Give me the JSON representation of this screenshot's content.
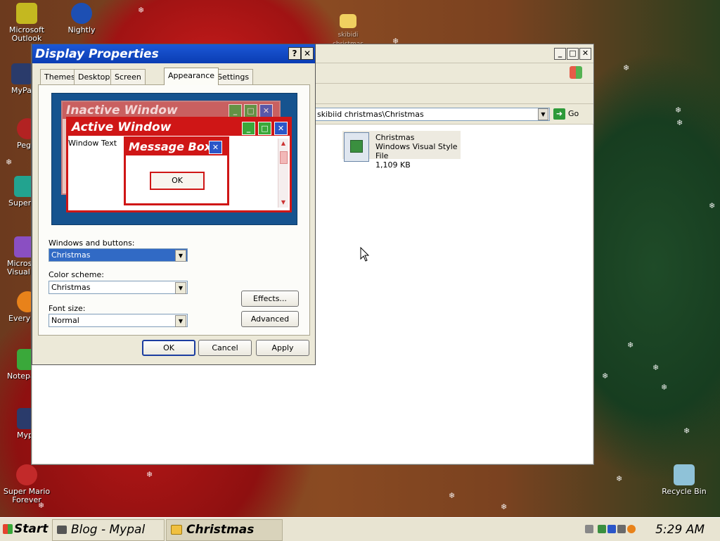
{
  "desktop": {
    "icons": [
      {
        "label": "Microsoft Outlook",
        "line1": "Microsoft",
        "line2": "Outlook",
        "icon": "outlook-icon",
        "color": "#c4b820"
      },
      {
        "label": "Nightly",
        "line1": "Nightly",
        "line2": "",
        "icon": "nightly-globe-icon",
        "color": "#1d4fb3"
      },
      {
        "label": "MyPal",
        "line1": "MyPal",
        "line2": "",
        "icon": "mypal-shortcut-icon",
        "color": "#2a3b6b"
      },
      {
        "label": "Peg",
        "line1": "Peg",
        "line2": "",
        "icon": "peg-shortcut-icon",
        "color": "#b22222"
      },
      {
        "label": "Super",
        "line1": "Super",
        "line2": "",
        "icon": "super-shortcut-icon",
        "color": "#22a38f"
      },
      {
        "label": "Micros Visual S",
        "line1": "Micros",
        "line2": "Visual S",
        "icon": "visual-studio-shortcut-icon",
        "color": "#8a4fc2"
      },
      {
        "label": "Everyo",
        "line1": "Everyo",
        "line2": "",
        "icon": "everything-shortcut-icon",
        "color": "#e8821a"
      },
      {
        "label": "Notepa",
        "line1": "Notepa",
        "line2": "",
        "icon": "notepad-shortcut-icon",
        "color": "#3aa83a"
      },
      {
        "label": "Myp",
        "line1": "Myp",
        "line2": "",
        "icon": "mypal2-shortcut-icon",
        "color": "#2a3b6b"
      },
      {
        "label": "Super Mario Forever",
        "line1": "Super Mario",
        "line2": "Forever",
        "icon": "super-mario-icon",
        "color": "#c22a2a"
      },
      {
        "label": "Recycle Bin",
        "line1": "Recycle Bin",
        "line2": "",
        "icon": "recycle-bin-icon",
        "color": "#8fc2d8"
      }
    ],
    "background_folder_label": "skibidi christmas"
  },
  "explorer": {
    "address": "skibiid christmas\\Christmas",
    "go_label": "Go",
    "file": {
      "name": "Christmas",
      "type": "Windows Visual Style File",
      "size": "1,109 KB"
    }
  },
  "dialog": {
    "title": "Display Properties",
    "help_label": "?",
    "close_label": "✕",
    "tabs": [
      {
        "label": "Themes",
        "active": false
      },
      {
        "label": "Desktop",
        "active": false
      },
      {
        "label": "Screen Saver",
        "active": false
      },
      {
        "label": "Appearance",
        "active": true
      },
      {
        "label": "Settings",
        "active": false
      }
    ],
    "preview": {
      "inactive_title": "Inactive Window",
      "active_title": "Active Window",
      "window_text": "Window Text",
      "message_box_title": "Message Box",
      "ok_label": "OK"
    },
    "windows_buttons_label": "Windows and buttons:",
    "windows_buttons_value": "Christmas",
    "color_scheme_label": "Color scheme:",
    "color_scheme_value": "Christmas",
    "font_size_label": "Font size:",
    "font_size_value": "Normal",
    "effects_label": "Effects...",
    "advanced_label": "Advanced",
    "ok_label": "OK",
    "cancel_label": "Cancel",
    "apply_label": "Apply"
  },
  "taskbar": {
    "start_label": "Start",
    "tasks": [
      {
        "label": "Blog - Mypal",
        "icon": "mypal-icon",
        "active": false
      },
      {
        "label": "Christmas",
        "icon": "folder-icon",
        "active": true
      }
    ],
    "clock": "5:29 AM"
  }
}
